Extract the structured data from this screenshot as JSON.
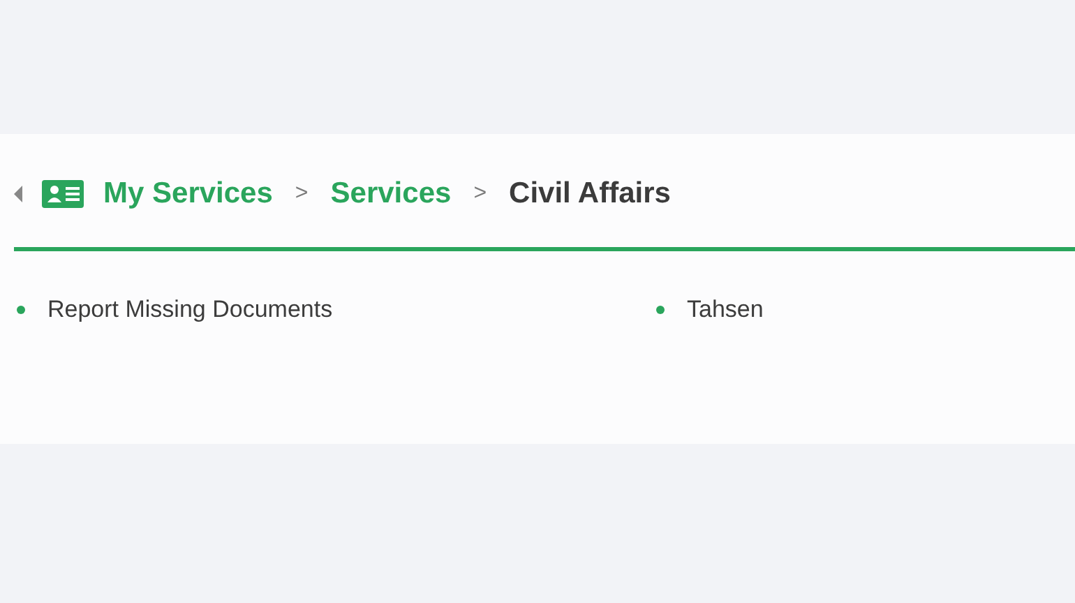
{
  "breadcrumb": [
    {
      "label": "My Services",
      "current": false
    },
    {
      "label": "Services",
      "current": false
    },
    {
      "label": "Civil Affairs",
      "current": true
    }
  ],
  "separator": ">",
  "services": [
    {
      "label": "Report Missing Documents"
    },
    {
      "label": "Tahsen"
    }
  ]
}
